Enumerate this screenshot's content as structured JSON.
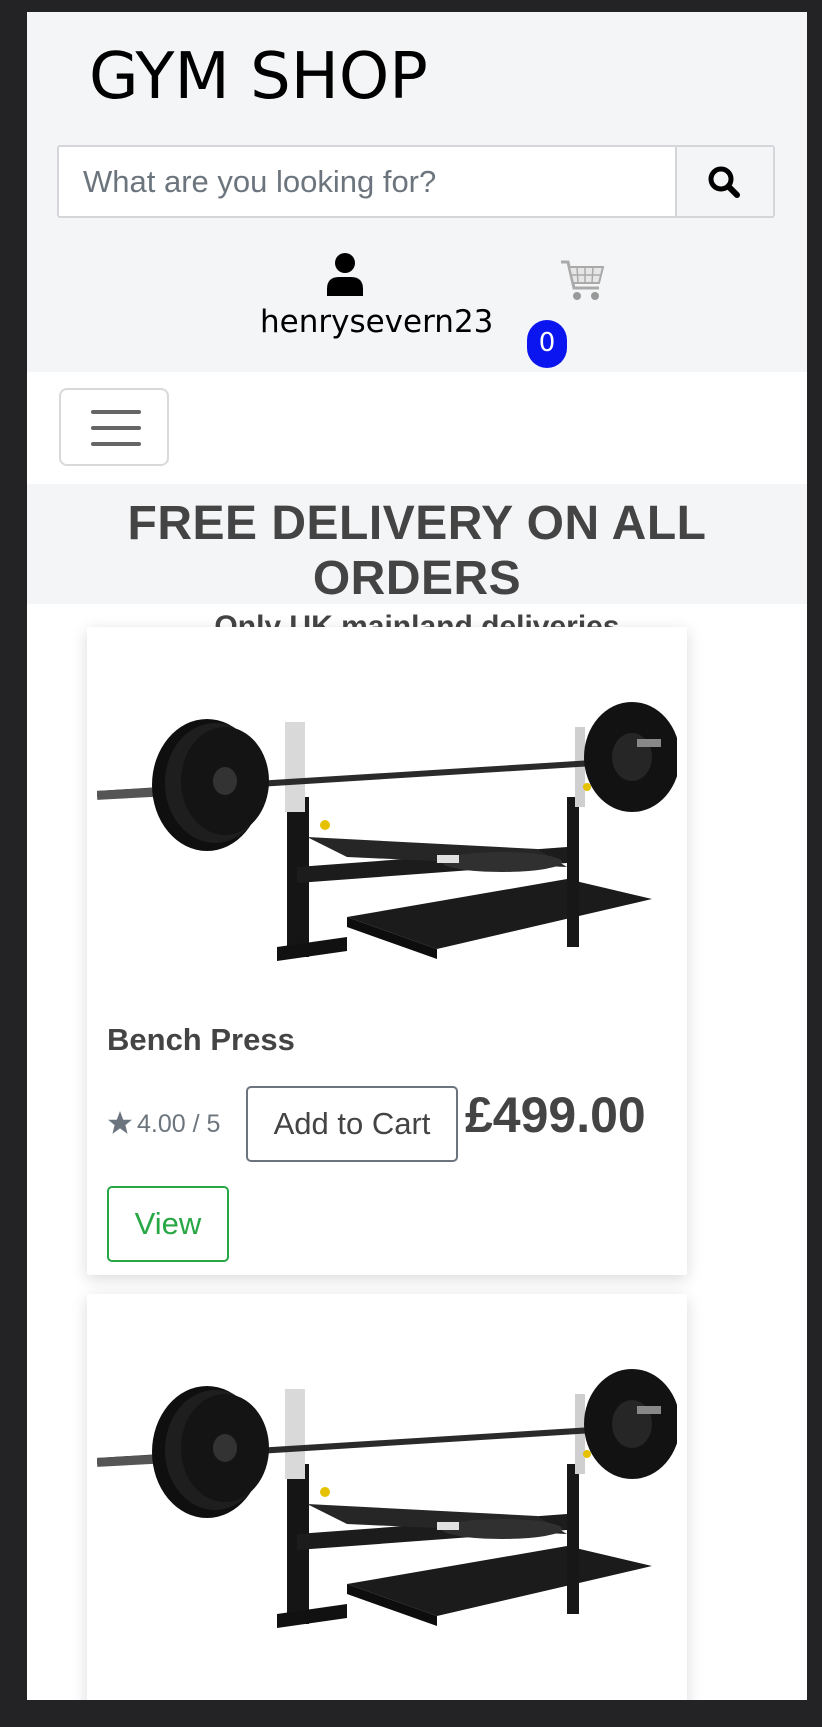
{
  "header": {
    "logo": "GYM SHOP",
    "search": {
      "placeholder": "What are you looking for?",
      "button_icon": "search-icon"
    },
    "account": {
      "icon": "user-icon",
      "username": "henrysevern23"
    },
    "cart": {
      "icon": "cart-icon",
      "count": "0"
    }
  },
  "navbar": {
    "toggler_icon": "hamburger-icon"
  },
  "banner": {
    "title": "FREE DELIVERY ON ALL ORDERS",
    "subtitle": "Only UK mainland deliveries"
  },
  "products": [
    {
      "name": "Bench Press",
      "rating": "4.00 / 5",
      "add_to_cart_label": "Add to Cart",
      "price": "£499.00",
      "view_label": "View",
      "image": "bench-press-image"
    },
    {
      "image": "bench-press-image"
    }
  ],
  "colors": {
    "header_bg": "#f4f5f7",
    "cart_badge": "#0a15f0",
    "view_button": "#28a745",
    "text": "#444444"
  }
}
